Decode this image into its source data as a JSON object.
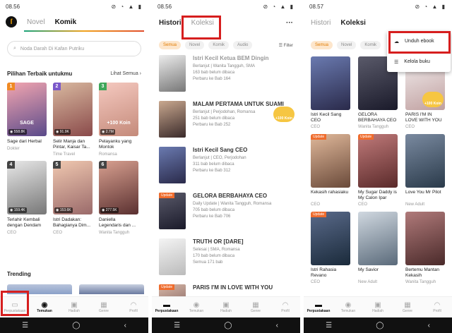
{
  "panel1": {
    "status": {
      "time": "08.56",
      "icons": "⊘ ◔ ▲ ▮"
    },
    "logo": "ſ",
    "tabs": [
      "Novel",
      "Komik"
    ],
    "search_placeholder": "Noda Darah Di Kafan Putriku",
    "section_title": "Pilihan Terbaik untukmu",
    "see_all": "Lihat Semua",
    "cards": [
      {
        "rank": "1",
        "rank_color": "#f08a24",
        "views": "558.8K",
        "title": "Sage dari Herbal",
        "sub": "Dokter",
        "cover_text": "SAGE",
        "colors": [
          "#f3a6b0",
          "#5a4a8a"
        ]
      },
      {
        "rank": "2",
        "rank_color": "#7a58c9",
        "views": "91.9K",
        "title": "Selir Manja dan Pintar, Kaisar Ta...",
        "sub": "Time Travel",
        "cover_text": "",
        "colors": [
          "#d9b9a0",
          "#8a4a4a"
        ]
      },
      {
        "rank": "3",
        "rank_color": "#3fa65a",
        "views": "2.7M",
        "title": "Pelayanku yang Montok",
        "sub": "Romansa",
        "cover_text": "+100 Koin",
        "colors": [
          "#f5c9c0",
          "#c48a7a"
        ]
      },
      {
        "rank": "4",
        "rank_color": "#444",
        "views": "159.4K",
        "title": "Terlahir Kembali dengan Dendam",
        "sub": "CEO",
        "cover_text": "",
        "colors": [
          "#e8e8e8",
          "#777"
        ]
      },
      {
        "rank": "5",
        "rank_color": "#444",
        "views": "153.6K",
        "title": "Istri Dadakan: Bahagianya Dim...",
        "sub": "CEO",
        "cover_text": "",
        "colors": [
          "#f0c8b0",
          "#9a6a6a"
        ]
      },
      {
        "rank": "6",
        "rank_color": "#444",
        "views": "277.5K",
        "title": "Daniella Legendaris dan ...",
        "sub": "Wanita Tangguh",
        "cover_text": "",
        "colors": [
          "#d8a090",
          "#5a3030"
        ]
      }
    ],
    "trending": "Trending",
    "nav": [
      "Perpustakaan",
      "Temukan",
      "Hadiah",
      "Genre",
      "Profil"
    ]
  },
  "panel2": {
    "status": {
      "time": "08.56",
      "icons": "⊘ ◔ ▲ ▮"
    },
    "tabs": [
      "Histori",
      "Koleksi"
    ],
    "menu": "···",
    "chips": [
      "Semua",
      "Novel",
      "Komik",
      "Audio"
    ],
    "filter": "Filter",
    "rows": [
      {
        "title": "Istri Kecil Ketua BEM Dingin",
        "tags": "Berlanjut | Wanita Tangguh, SMA",
        "unread": "163 bab belum dibaca",
        "updated": "Perbaru ke Bab 164",
        "update": "",
        "coin": "",
        "colors": [
          "#ececec",
          "#777"
        ],
        "dim": true
      },
      {
        "title": "MALAM PERTAMA UNTUK SUAMI",
        "tags": "Berlanjut | Perjodohan, Romansa",
        "unread": "251 bab belum dibaca",
        "updated": "Perbaru ke Bab 252",
        "update": "",
        "coin": "+100 Koin",
        "colors": [
          "#c9a88f",
          "#3a2a2a"
        ],
        "dim": false
      },
      {
        "title": "Istri Kecil Sang CEO",
        "tags": "Berlanjut | CEO, Perjodohan",
        "unread": "311 bab belum dibaca",
        "updated": "Perbaru ke Bab 312",
        "update": "",
        "coin": "",
        "colors": [
          "#6a7ab0",
          "#2a2a4a"
        ],
        "dim": false
      },
      {
        "title": "GELORA BERBAHAYA CEO",
        "tags": "Daily Update | Wanita Tangguh, Romansa",
        "unread": "705 bab belum dibaca",
        "updated": "Perbaru ke Bab 706",
        "update": "Update",
        "coin": "",
        "colors": [
          "#5a5a6a",
          "#1a1a2a"
        ],
        "dim": false
      },
      {
        "title": "TRUTH OR [DARE]",
        "tags": "Selesai | SMA, Romansa",
        "unread": "170 bab belum dibaca",
        "updated": "Semua 171 bab",
        "update": "",
        "coin": "",
        "colors": [
          "#f4f4f4",
          "#bbb"
        ],
        "dim": false
      },
      {
        "title": "PARIS I'M IN LOVE WITH YOU",
        "tags": "",
        "unread": "",
        "updated": "",
        "update": "Update",
        "coin": "",
        "colors": [
          "#d8b8a8",
          "#6a4a4a"
        ],
        "dim": false
      }
    ],
    "nav": [
      "Perpustakaan",
      "Temukan",
      "Hadiah",
      "Genre",
      "Profil"
    ]
  },
  "panel3": {
    "status": {
      "time": "08.57",
      "icons": "⊘ ◔ ▲ ▮"
    },
    "tabs": [
      "Histori",
      "Koleksi"
    ],
    "chips": [
      "Semua",
      "Novel",
      "Komik"
    ],
    "popup": [
      "Unduh ebook",
      "Kelola buku"
    ],
    "cards": [
      {
        "title": "Istri Kecil Sang CEO",
        "sub": "CEO",
        "update": "",
        "coin": "",
        "colors": [
          "#6a7ab0",
          "#2a2a4a"
        ]
      },
      {
        "title": "GELORA BERBAHAYA CEO",
        "sub": "Wanita Tangguh",
        "update": "",
        "coin": "",
        "colors": [
          "#5a5a6a",
          "#1a1a2a"
        ]
      },
      {
        "title": "PARIS I'M IN LOVE WITH YOU",
        "sub": "CEO",
        "update": "",
        "coin": "+100 Koin",
        "colors": [
          "#f4f0f0",
          "#c0a0a0"
        ]
      },
      {
        "title": "Kekasih rahasiaku",
        "sub": "CEO",
        "update": "Update",
        "coin": "",
        "colors": [
          "#e0b89a",
          "#6a4a3a"
        ]
      },
      {
        "title": "My Sugar Daddy is My Calon Ipar",
        "sub": "CEO",
        "update": "Update",
        "coin": "",
        "colors": [
          "#c07a7a",
          "#5a2a2a"
        ]
      },
      {
        "title": "Love You Mr Pilot",
        "sub": "New Adult",
        "update": "",
        "coin": "",
        "colors": [
          "#7a8aa0",
          "#2a3a4a"
        ]
      },
      {
        "title": "Istri Rahasia Revano",
        "sub": "CEO",
        "update": "Update",
        "coin": "",
        "colors": [
          "#5a6a8a",
          "#1a2a3a"
        ]
      },
      {
        "title": "My Savior",
        "sub": "New Adult",
        "update": "",
        "coin": "",
        "colors": [
          "#d0d8e0",
          "#5a6a7a"
        ]
      },
      {
        "title": "Bertemu Mantan Kekasih",
        "sub": "Wanita Tangguh",
        "update": "",
        "coin": "",
        "colors": [
          "#b07a7a",
          "#4a2a2a"
        ]
      }
    ],
    "nav": [
      "Perpustakaan",
      "Temukan",
      "Hadiah",
      "Genre",
      "Profil"
    ]
  },
  "sysnav": [
    "☰",
    "◯",
    "‹"
  ],
  "accent": "#e04b2a",
  "highlight": "#d61e1e"
}
